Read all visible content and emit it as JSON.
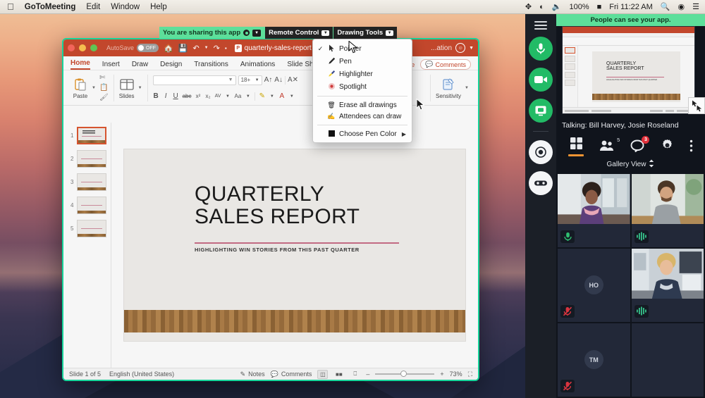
{
  "menubar": {
    "apple_icon": "apple-icon",
    "items": [
      "GoToMeeting",
      "Edit",
      "Window",
      "Help"
    ],
    "status": {
      "arrows_icon": "move-arrows-icon",
      "wifi_icon": "wifi-icon",
      "volume_icon": "volume-icon",
      "battery_percent": "100%",
      "battery_icon": "battery-icon",
      "clock": "Fri 11:22 AM",
      "search_icon": "search-icon",
      "siri_icon": "siri-icon",
      "control_center_icon": "control-center-icon"
    }
  },
  "sharebar": {
    "sharing_label": "You are sharing this app",
    "remote_control": "Remote Control",
    "drawing_tools": "Drawing Tools"
  },
  "powerpoint": {
    "titlebar": {
      "autosave_label": "AutoSave",
      "autosave_state": "OFF",
      "home_icon": "home-icon",
      "save_icon": "save-icon",
      "undo_icon": "undo-icon",
      "redo_icon": "redo-icon",
      "more_icon": "more-icon",
      "document_name": "quarterly-sales-report",
      "hidden_label": "...ation",
      "account_icon": "account-icon"
    },
    "tabs": [
      "Home",
      "Insert",
      "Draw",
      "Design",
      "Transitions",
      "Animations",
      "Slide Show"
    ],
    "active_tab": "Home",
    "tab_right": {
      "share_label": "...re",
      "comments_label": "Comments",
      "comments_icon": "comment-icon"
    },
    "ribbon": {
      "paste_label": "Paste",
      "paste_icon": "paste-icon",
      "cut_icon": "scissors-icon",
      "copy_icon": "copy-icon",
      "format_painter_icon": "format-painter-icon",
      "slides_label": "Slides",
      "slides_icon": "new-slide-icon",
      "font_name": "",
      "font_size": "18+",
      "grow_font_icon": "grow-font-icon",
      "shrink_font_icon": "shrink-font-icon",
      "clear_format_icon": "clear-formatting-icon",
      "bold": "B",
      "italic": "I",
      "underline": "U",
      "strikethrough": "abc",
      "superscript": "x²",
      "subscript": "x₂",
      "char_spacing_icon": "character-spacing-icon",
      "change_case_icon": "change-case-icon",
      "highlight_icon": "text-highlight-icon",
      "font_color_icon": "font-color-icon",
      "sensitivity_label": "Sensitivity",
      "sensitivity_icon": "sensitivity-icon"
    },
    "thumbnails": [
      {
        "number": "1",
        "selected": true
      },
      {
        "number": "2",
        "selected": false
      },
      {
        "number": "3",
        "selected": false
      },
      {
        "number": "4",
        "selected": false
      },
      {
        "number": "5",
        "selected": false
      }
    ],
    "slide": {
      "title_line1": "QUARTERLY",
      "title_line2": "SALES REPORT",
      "subtitle": "HIGHLIGHTING WIN STORIES FROM THIS PAST QUARTER"
    },
    "status": {
      "slide_counter": "Slide 1 of 5",
      "language": "English (United States)",
      "notes_label": "Notes",
      "notes_icon": "notes-icon",
      "comments_label": "Comments",
      "comments_icon": "comment-icon",
      "normal_view_icon": "normal-view-icon",
      "sorter_view_icon": "slide-sorter-icon",
      "reading_view_icon": "reading-view-icon",
      "zoom_out": "–",
      "zoom_in": "+",
      "zoom_level": "73%",
      "fit_slide_icon": "fit-to-window-icon"
    }
  },
  "drawing_menu": {
    "items": [
      {
        "label": "Pointer",
        "checked": true,
        "icon": "pointer-icon"
      },
      {
        "label": "Pen",
        "checked": false,
        "icon": "pen-icon"
      },
      {
        "label": "Highlighter",
        "checked": false,
        "icon": "highlighter-icon"
      },
      {
        "label": "Spotlight",
        "checked": false,
        "icon": "spotlight-icon"
      }
    ],
    "actions": [
      {
        "label": "Erase all drawings",
        "icon": "eraser-icon"
      },
      {
        "label": "Attendees can draw",
        "icon": "attendees-draw-icon"
      }
    ],
    "color_item": {
      "label": "Choose Pen Color",
      "icon": "color-swatch-icon",
      "arrow": "▶"
    }
  },
  "gotomeeting": {
    "rail": {
      "menu_icon": "hamburger-menu-icon",
      "mic_icon": "microphone-icon",
      "camera_icon": "camera-icon",
      "share_screen_icon": "share-screen-icon",
      "record_icon": "record-icon",
      "drawing_icon": "drawing-tools-icon"
    },
    "banner": "People can see your app.",
    "preview": {
      "slide_title_line1": "QUARTERLY",
      "slide_title_line2": "SALES REPORT",
      "slide_subtitle": "HIGHLIGHTING WIN STORIES FROM THIS PAST QUARTER",
      "grip_icon": "resize-grip-icon"
    },
    "talking": "Talking: Bill Harvey, Josie Roseland",
    "toolbar": {
      "gallery_icon": "gallery-grid-icon",
      "people_icon": "people-icon",
      "people_count": "5",
      "chat_icon": "chat-icon",
      "chat_badge": "3",
      "settings_icon": "gear-icon",
      "more_icon": "more-vertical-icon"
    },
    "view_selector": {
      "label": "Gallery View",
      "icon": "chevron-updown-icon"
    },
    "tiles": [
      {
        "type": "video",
        "mic": "unmuted-speaking",
        "scene": "woman-pink-scarf"
      },
      {
        "type": "video",
        "mic": "speaking-waveform",
        "scene": "man-grey-shirt"
      },
      {
        "type": "avatar",
        "initials": "HO",
        "mic": "muted"
      },
      {
        "type": "video",
        "mic": "speaking-waveform",
        "scene": "woman-office"
      },
      {
        "type": "avatar",
        "initials": "TM",
        "mic": "muted"
      },
      {
        "type": "empty",
        "mic": "none"
      }
    ]
  },
  "colors": {
    "accent_green": "#5ddf9a",
    "powerpoint_red": "#c2472c",
    "badge_red": "#e0303a",
    "orange_underline": "#f09433"
  }
}
